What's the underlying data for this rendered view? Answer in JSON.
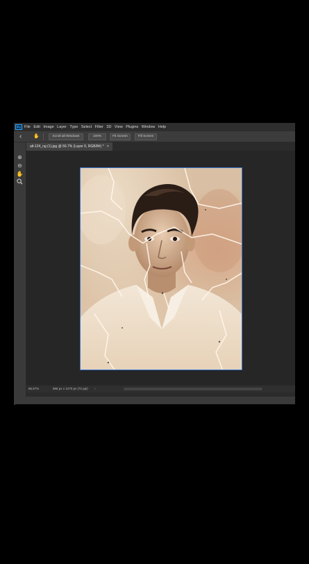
{
  "menubar": {
    "logo": "Ps",
    "items": [
      "File",
      "Edit",
      "Image",
      "Layer",
      "Type",
      "Select",
      "Filter",
      "3D",
      "View",
      "Plugins",
      "Window",
      "Help"
    ]
  },
  "options_bar": {
    "back_icon": "back-arrow-icon",
    "hand_icon": "hand-icon",
    "scroll_all_windows": "Scroll all Windows",
    "zoom_100": "100%",
    "fit_screen": "Fit Screen",
    "fill_screen": "Fill Screen"
  },
  "document_tab": {
    "title": "alt-124_ng (1).jpg @ 66.7% (Layer 0, RGB/8#) *",
    "close": "×"
  },
  "tools": [
    "zoom-in-icon",
    "zoom-out-icon",
    "hand-icon",
    "search-icon"
  ],
  "canvas": {
    "image_description_icon": "photo-portrait"
  },
  "status_bar": {
    "zoom": "66.67%",
    "doc_info": "966 px x 1270 px (72 ppi)",
    "arrow": "›"
  },
  "colors": {
    "accent_blue": "#3d7bd8",
    "ps_blue": "#31a8ff"
  }
}
